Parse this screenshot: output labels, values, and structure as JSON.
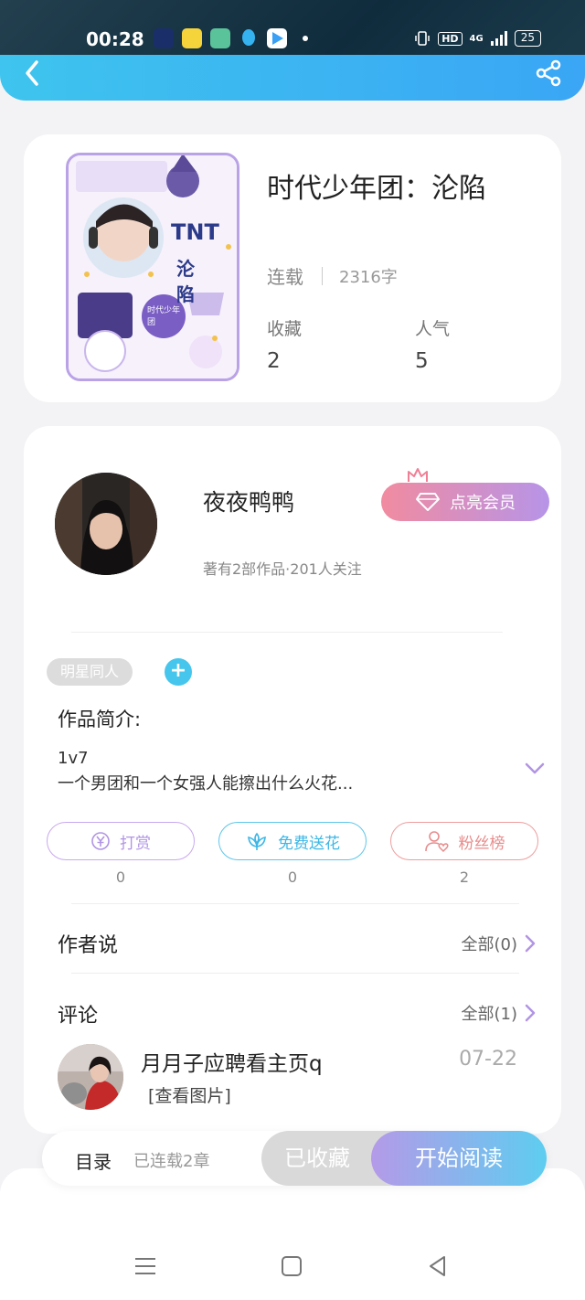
{
  "status_bar": {
    "time": "00:28",
    "hd": "HD",
    "network": "4G",
    "battery": "25"
  },
  "book": {
    "title": "时代少年团：沦陷",
    "status": "连载",
    "word_count": "2316字",
    "stats": [
      {
        "label": "收藏",
        "value": "2"
      },
      {
        "label": "人气",
        "value": "5"
      }
    ],
    "cover_text": {
      "line1": "TNT",
      "line2": "沦陷",
      "badge": "时代少年团"
    }
  },
  "author": {
    "name": "夜夜鸭鸭",
    "meta": "著有2部作品·201人关注",
    "vip_button": "点亮会员"
  },
  "tags": [
    "明星同人"
  ],
  "intro": {
    "label": "作品简介:",
    "line1": "1v7",
    "line2": "一个男团和一个女强人能擦出什么火花..."
  },
  "actions": [
    {
      "label": "打赏",
      "count": "0"
    },
    {
      "label": "免费送花",
      "count": "0"
    },
    {
      "label": "粉丝榜",
      "count": "2"
    }
  ],
  "author_says": {
    "title": "作者说",
    "link": "全部(0)"
  },
  "comments": {
    "title": "评论",
    "link": "全部(1)",
    "items": [
      {
        "user": "月月子应聘看主页q",
        "date": "07-22",
        "text": "[查看图片]"
      }
    ]
  },
  "bottom": {
    "toc": "目录",
    "chapters": "已连载2章",
    "favorite": "已收藏",
    "read": "开始阅读"
  },
  "colors": {
    "accent_blue": "#3ec4ee",
    "accent_purple": "#b49ae8",
    "vip_pink": "#f18ba0"
  }
}
